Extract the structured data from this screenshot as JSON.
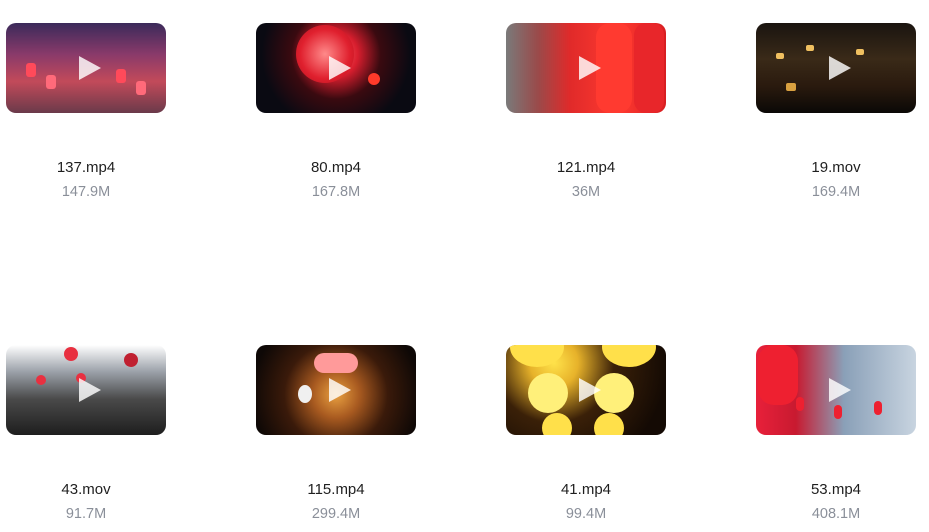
{
  "files": [
    {
      "name": "137.mp4",
      "size": "147.9M"
    },
    {
      "name": "80.mp4",
      "size": "167.8M"
    },
    {
      "name": "121.mp4",
      "size": "36M"
    },
    {
      "name": "19.mov",
      "size": "169.4M"
    },
    {
      "name": "43.mov",
      "size": "91.7M"
    },
    {
      "name": "115.mp4",
      "size": "299.4M"
    },
    {
      "name": "41.mp4",
      "size": "99.4M"
    },
    {
      "name": "53.mp4",
      "size": "408.1M"
    }
  ],
  "icons": {
    "play": "play-icon"
  },
  "colors": {
    "filename": "#1f1f1f",
    "filesize": "#8a8f99",
    "background": "#ffffff"
  }
}
